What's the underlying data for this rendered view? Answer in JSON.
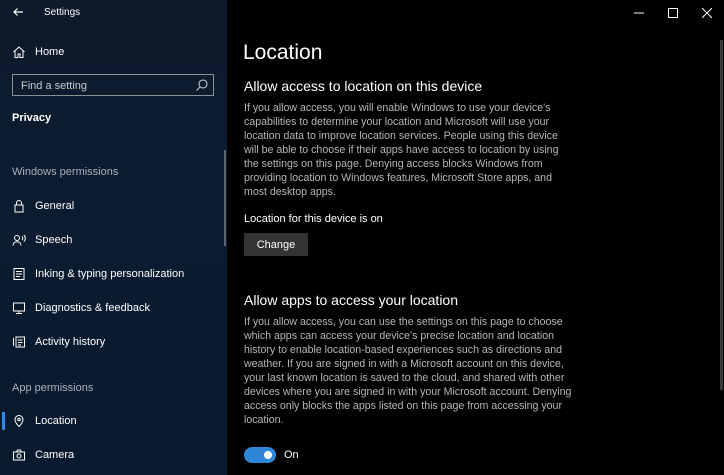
{
  "window": {
    "title": "Settings"
  },
  "sidebar": {
    "home_label": "Home",
    "search_placeholder": "Find a setting",
    "section_title": "Privacy",
    "windows_permissions_header": "Windows permissions",
    "windows_permissions": [
      {
        "label": "General",
        "icon": "lock-icon"
      },
      {
        "label": "Speech",
        "icon": "speech-icon"
      },
      {
        "label": "Inking & typing personalization",
        "icon": "inking-icon"
      },
      {
        "label": "Diagnostics & feedback",
        "icon": "diagnostics-icon"
      },
      {
        "label": "Activity history",
        "icon": "activity-history-icon"
      }
    ],
    "app_permissions_header": "App permissions",
    "app_permissions": [
      {
        "label": "Location",
        "icon": "location-icon",
        "selected": true
      },
      {
        "label": "Camera",
        "icon": "camera-icon"
      }
    ]
  },
  "main": {
    "page_title": "Location",
    "device_section": {
      "heading": "Allow access to location on this device",
      "description": "If you allow access, you will enable Windows to use your device's capabilities to determine your location and Microsoft will use your location data to improve location services. People using this device will be able to choose if their apps have access to location by using the settings on this page. Denying access blocks Windows from providing location to Windows features, Microsoft Store apps, and most desktop apps.",
      "status": "Location for this device is on",
      "change_label": "Change"
    },
    "apps_section": {
      "heading": "Allow apps to access your location",
      "description": "If you allow access, you can use the settings on this page to choose which apps can access your device's precise location and location history to enable location-based experiences such as directions and weather. If you are signed in with a Microsoft account on this device, your last known location is saved to the cloud, and shared with other devices where you are signed in with your Microsoft account. Denying access only blocks the apps listed on this page from accessing your location.",
      "toggle_state": "On"
    }
  },
  "colors": {
    "accent": "#2d86d7",
    "sidebar_bg": "#0c1c30",
    "main_bg": "#000000"
  }
}
